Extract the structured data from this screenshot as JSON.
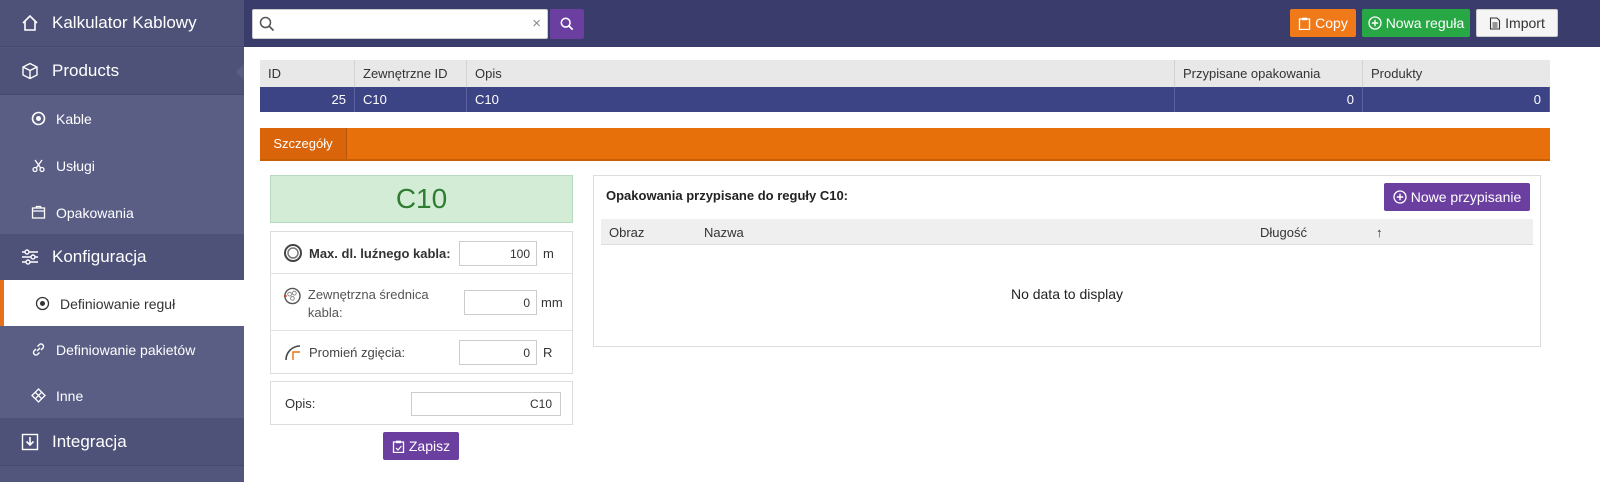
{
  "sidebar": {
    "app_title": "Kalkulator Kablowy",
    "products": "Products",
    "kable": "Kable",
    "uslugi": "Usługi",
    "opakowania": "Opakowania",
    "konfiguracja": "Konfiguracja",
    "definiowanie_regul": "Definiowanie reguł",
    "definiowanie_pakietow": "Definiowanie pakietów",
    "inne": "Inne",
    "integracja": "Integracja"
  },
  "toolbar": {
    "search_placeholder": "",
    "clear_glyph": "×",
    "copy": "Copy",
    "nowa_regula": "Nowa reguła",
    "import": "Import"
  },
  "grid": {
    "columns": [
      "ID",
      "Zewnętrzne ID",
      "Opis",
      "Przypisane opakowania",
      "Produkty"
    ],
    "rows": [
      [
        "25",
        "C10",
        "C10",
        "0",
        "0"
      ]
    ]
  },
  "tabs": {
    "szczegoly": "Szczegóły"
  },
  "details": {
    "name": "C10",
    "max_label": "Max. dl. luźnego kabla:",
    "max_value": "100",
    "max_unit": "m",
    "diameter_label": "Zewnętrzna średnica kabla:",
    "diameter_value": "0",
    "diameter_unit": "mm",
    "radius_label": "Promień zgięcia:",
    "radius_value": "0",
    "radius_unit": "R",
    "opis_label": "Opis:",
    "opis_value": "C10",
    "save": "Zapisz"
  },
  "assignments": {
    "title": "Opakowania przypisane do reguły C10:",
    "new_button": "Nowe przypisanie",
    "columns": [
      "Obraz",
      "Nazwa",
      "Długość",
      "↑"
    ],
    "empty_text": "No data to display"
  },
  "colors": {
    "sidebar": "#52567d",
    "topbar": "#3a3c6b",
    "accent_orange": "#e8700a",
    "accent_purple": "#6b3fa0",
    "green": "#28a745",
    "selected_row": "#3d4485"
  }
}
